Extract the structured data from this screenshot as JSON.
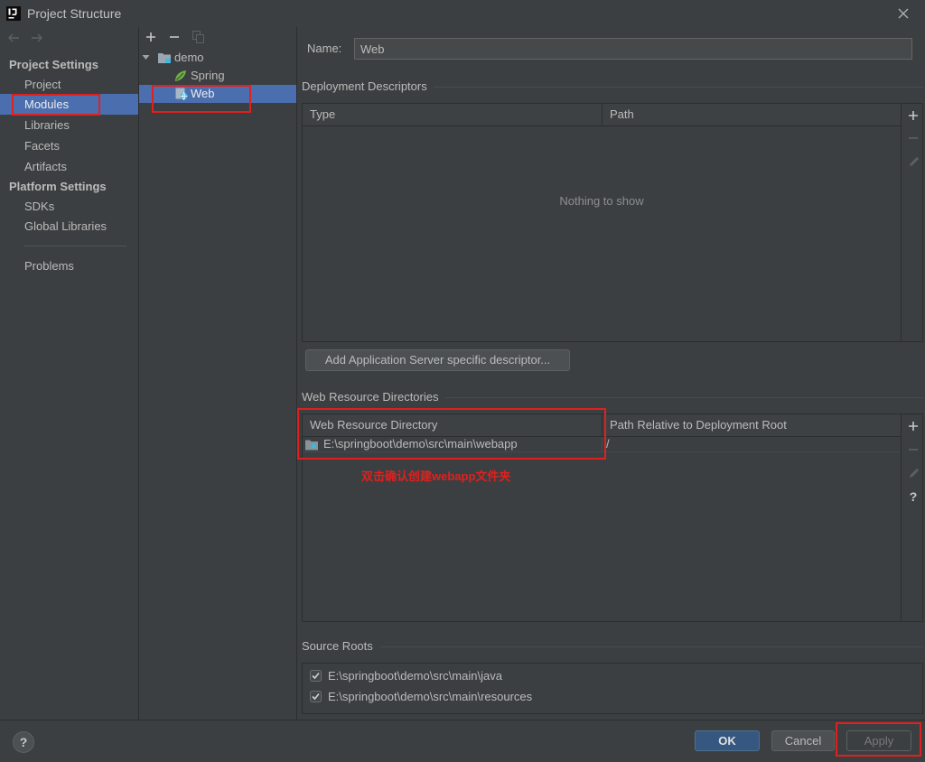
{
  "window": {
    "title": "Project Structure",
    "logo_lettering": "IJ",
    "icons": {
      "app": "intellij-idea-icon",
      "close": "close-icon"
    }
  },
  "nav": {
    "icons": {
      "back": "arrow-left-icon",
      "forward": "arrow-right-icon"
    },
    "project_settings": {
      "header": "Project Settings",
      "items": [
        {
          "label": "Project",
          "selected": false
        },
        {
          "label": "Modules",
          "selected": true
        },
        {
          "label": "Libraries",
          "selected": false
        },
        {
          "label": "Facets",
          "selected": false
        },
        {
          "label": "Artifacts",
          "selected": false
        }
      ]
    },
    "platform_settings": {
      "header": "Platform Settings",
      "items": [
        {
          "label": "SDKs",
          "selected": false
        },
        {
          "label": "Global Libraries",
          "selected": false
        }
      ]
    },
    "problems": {
      "label": "Problems"
    }
  },
  "module_tree": {
    "toolbar": [
      {
        "icon": "add-icon",
        "enabled": true
      },
      {
        "icon": "remove-icon",
        "enabled": true
      },
      {
        "icon": "copy-icon",
        "enabled": false
      }
    ],
    "root": {
      "label": "demo",
      "icon": "module-folder-icon",
      "expanded": true
    },
    "children": [
      {
        "label": "Spring",
        "icon": "spring-leaf-icon",
        "selected": false
      },
      {
        "label": "Web",
        "icon": "web-facet-icon",
        "selected": true
      }
    ]
  },
  "facet_editor": {
    "name": {
      "label": "Name:",
      "value": "Web"
    },
    "deployment_descriptors": {
      "title": "Deployment Descriptors",
      "columns": [
        "Type",
        "Path"
      ],
      "rows": [],
      "empty_text": "Nothing to show",
      "toolbar": [
        {
          "icon": "add-icon",
          "enabled": true
        },
        {
          "icon": "remove-icon",
          "enabled": false
        },
        {
          "icon": "edit-icon",
          "enabled": false
        }
      ],
      "add_descriptor_button": "Add Application Server specific descriptor..."
    },
    "web_resource_directories": {
      "title": "Web Resource Directories",
      "columns": [
        "Web Resource Directory",
        "Path Relative to Deployment Root"
      ],
      "rows": [
        {
          "directory": "E:\\springboot\\demo\\src\\main\\webapp",
          "relative_path": "/",
          "icon": "web-folder-icon"
        }
      ],
      "toolbar": [
        {
          "icon": "add-icon",
          "enabled": true
        },
        {
          "icon": "remove-icon",
          "enabled": false
        },
        {
          "icon": "edit-icon",
          "enabled": false
        },
        {
          "icon": "help-icon",
          "enabled": true
        }
      ],
      "help_glyph": "?"
    },
    "source_roots": {
      "title": "Source Roots",
      "items": [
        {
          "path": "E:\\springboot\\demo\\src\\main\\java",
          "checked": true
        },
        {
          "path": "E:\\springboot\\demo\\src\\main\\resources",
          "checked": true
        }
      ]
    }
  },
  "annotation": {
    "note": "双击确认创建webapp文件夹"
  },
  "footer": {
    "help_glyph": "?",
    "ok": "OK",
    "cancel": "Cancel",
    "apply": "Apply",
    "apply_enabled": false
  },
  "colors": {
    "bg": "#3c3f41",
    "text": "#bbbbbb",
    "selection": "#4b6eaf",
    "annotation": "#e0201f",
    "ok_button": "#365880"
  }
}
